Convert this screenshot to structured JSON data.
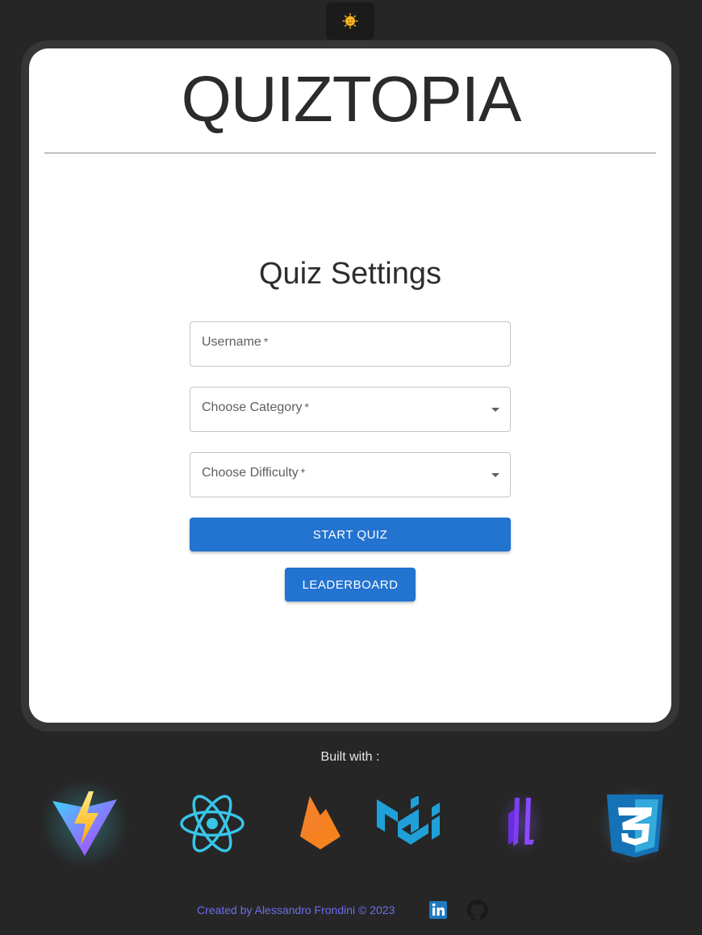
{
  "header": {
    "theme_toggle": {
      "icon": "sun-icon",
      "label": "Toggle theme"
    },
    "app_title": "QUIZTOPIA"
  },
  "settings": {
    "title": "Quiz Settings",
    "username": {
      "label": "Username",
      "required_mark": "*",
      "value": ""
    },
    "category": {
      "label": "Choose Category",
      "required_mark": "*",
      "value": ""
    },
    "difficulty": {
      "label": "Choose Difficulty",
      "required_mark": "*",
      "value": ""
    },
    "start_button": "START QUIZ",
    "leaderboard_button": "LEADERBOARD"
  },
  "built_with": {
    "label": "Built with :",
    "logos": [
      "vite-logo",
      "react-logo",
      "firebase-logo",
      "mui-logo",
      "ls-logo",
      "css3-logo"
    ]
  },
  "footer": {
    "credit": "Created by Alessandro Frondini © 2023",
    "links": [
      "linkedin-icon",
      "github-icon"
    ]
  },
  "colors": {
    "background": "#262626",
    "card": "#ffffff",
    "primary_button": "#2373d0",
    "footer_text": "#6d6df0"
  }
}
